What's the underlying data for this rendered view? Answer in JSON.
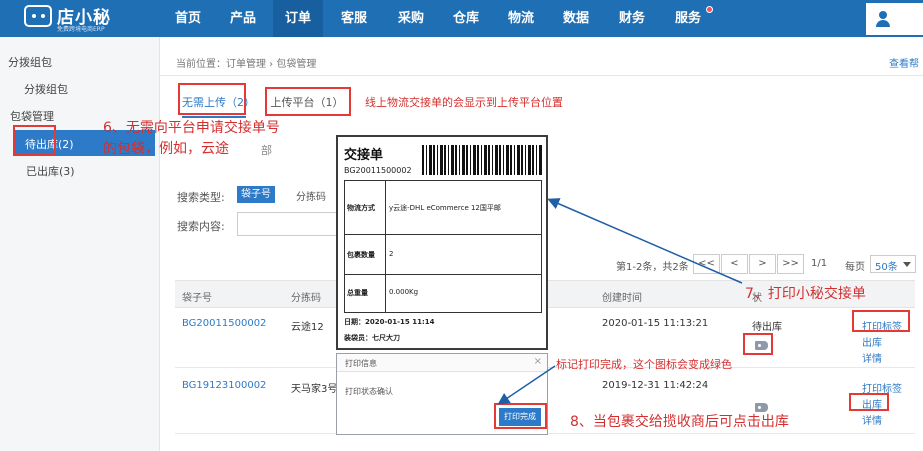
{
  "app": {
    "logo_name": "店小秘",
    "logo_tagline": "免费跨境电商ERP"
  },
  "nav": {
    "items": [
      "首页",
      "产品",
      "订单",
      "客服",
      "采购",
      "仓库",
      "物流",
      "数据",
      "财务",
      "服务"
    ],
    "active": "订单"
  },
  "sidebar": {
    "group1": "分拨组包",
    "group1_item": "分拨组包",
    "group2": "包袋管理",
    "active_item": "待出库(2)",
    "item2": "已出库(3)"
  },
  "breadcrumb": "当前位置：订单管理 › 包袋管理",
  "help_link": "查看帮",
  "tabs": [
    {
      "label": "无需上传（2）",
      "active": true
    },
    {
      "label": "上传平台（1）",
      "active": false
    }
  ],
  "annotations": {
    "n_upload": "线上物流交接单的会显示到上传平台位置",
    "n6_line1": "6、无需向平台申请交接单号",
    "n6_line2": "的包袋，例如，云途",
    "n6_residual": "部",
    "n7": "7、打印小秘交接单",
    "n_mark": "标记打印完成，这个图标会变成绿色",
    "n8": "8、当包裹交给揽收商后可点击出库"
  },
  "filter": {
    "type_label": "搜索类型:",
    "type_active": "袋子号",
    "type_other": "分拣码",
    "content_label": "搜索内容:"
  },
  "pager": {
    "info": "第1-2条，共2条",
    "first": "<<",
    "prev": "<",
    "next": ">",
    "last": ">>",
    "page": "1/1",
    "per_page_label": "每页",
    "per_page_value": "50条"
  },
  "table": {
    "headers": [
      "袋子号",
      "分拣码",
      "创建时间",
      "状"
    ],
    "rows": [
      {
        "bag_no": "BG20011500002",
        "sort_code": "云途12",
        "created": "2020-01-15 11:13:21",
        "status": "待出库",
        "actions": [
          "打印标签",
          "出库",
          "详情"
        ]
      },
      {
        "bag_no": "BG19123100002",
        "sort_code": "天马家3号",
        "created": "2019-12-31 11:42:24",
        "status": "",
        "actions": [
          "打印标签",
          "出库",
          "详情"
        ]
      }
    ]
  },
  "waybill": {
    "title": "交接单",
    "number": "BG20011500002",
    "rows": [
      {
        "key": "物流方式",
        "value": "y云途-DHL eCommerce 12国平邮"
      },
      {
        "key": "包裹数量",
        "value": "2"
      },
      {
        "key": "总重量",
        "value": "0.000Kg"
      }
    ],
    "date": "日期：2020-01-15 11:14",
    "packer": "装袋员：七尺大刀"
  },
  "dialog": {
    "title": "打印信息",
    "close": "×",
    "body": "打印状态确认",
    "button": "打印完成"
  }
}
